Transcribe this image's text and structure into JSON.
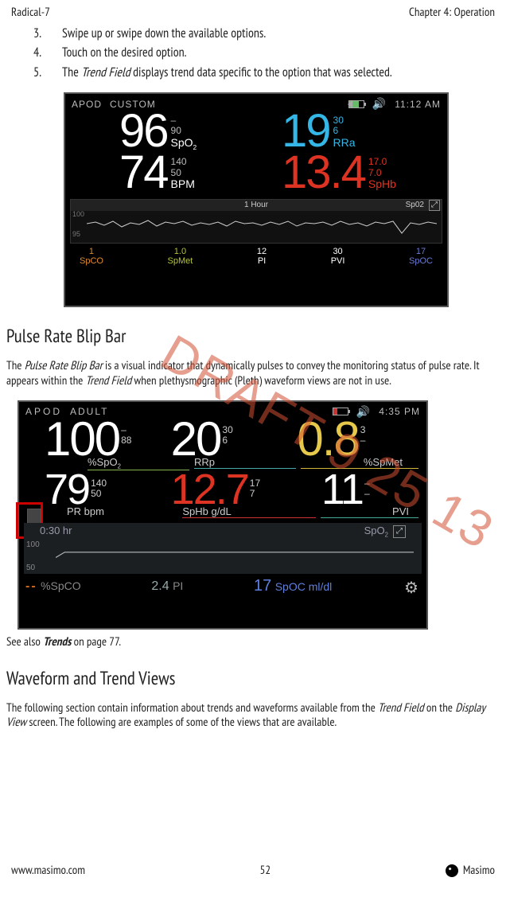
{
  "header": {
    "left": "Radical-7",
    "right": "Chapter 4: Operation"
  },
  "steps": [
    {
      "n": "3.",
      "text": "Swipe up or swipe down the available options."
    },
    {
      "n": "4.",
      "text": "Touch on the desired option."
    },
    {
      "n": "5.",
      "prefix": "The ",
      "em1": "Trend Field",
      "suffix": " displays trend data specific to the option that was selected."
    }
  ],
  "device1": {
    "status": {
      "mode1": "APOD",
      "mode2": "CUSTOM",
      "time": "11:12 AM"
    },
    "row1": {
      "spo2": {
        "v": "96",
        "hi": "–",
        "lo": "90",
        "lab": "SpO2"
      },
      "rra": {
        "v": "19",
        "hi": "30",
        "lo": "6",
        "lab": "RRa"
      }
    },
    "row2": {
      "bpm": {
        "v": "74",
        "hi": "140",
        "lo": "50",
        "lab": "BPM"
      },
      "sphb": {
        "v": "13.4",
        "hi": "17.0",
        "lo": "7.0",
        "lab": "SpHb"
      }
    },
    "trend": {
      "span": "1 Hour",
      "param": "Sp02",
      "y1": "100",
      "y2": "95"
    },
    "footer": [
      {
        "v": "1",
        "l": "SpCO",
        "cls": "orange"
      },
      {
        "v": "1.0",
        "l": "SpMet",
        "cls": "olive"
      },
      {
        "v": "12",
        "l": "PI",
        "cls": "white"
      },
      {
        "v": "30",
        "l": "PVI",
        "cls": "white"
      },
      {
        "v": "17",
        "l": "SpOC",
        "cls": "blue"
      }
    ]
  },
  "section1": {
    "title": "Pulse Rate Blip Bar",
    "p_a": "The ",
    "p_em1": "Pulse Rate Blip Bar",
    "p_b": " is a visual indicator that dynamically pulses to convey the monitoring status of pulse rate. It appears within the ",
    "p_em2": "Trend Field",
    "p_c": " when plethysmographic (Pleth) waveform views are not in use."
  },
  "device2": {
    "status": {
      "mode1": "APOD",
      "mode2": "ADULT",
      "time": "4:35 PM"
    },
    "row1": {
      "spo2": {
        "v": "100",
        "hi": "–",
        "lo": "88",
        "lab": "%SpO2"
      },
      "rrp": {
        "v": "20",
        "hi": "30",
        "lo": "6",
        "lab": "RRp"
      },
      "spmet": {
        "v": "0.8",
        "hi": "3",
        "lo": "–",
        "lab": "%SpMet"
      }
    },
    "row2": {
      "pr": {
        "v": "79",
        "hi": "140",
        "lo": "50",
        "lab": "PR bpm"
      },
      "sphb": {
        "v": "12.7",
        "hi": "17",
        "lo": "7",
        "lab": "SpHb g/dL"
      },
      "pvi": {
        "v": "11",
        "hi": "–",
        "lo": "–",
        "lab": "PVI"
      }
    },
    "trend": {
      "span": "0:30 hr",
      "param": "SpO2",
      "y1": "100",
      "y2": "50"
    },
    "footer": {
      "spco_dash": "--",
      "spco_lab": "%SpCO",
      "pi_v": "2.4",
      "pi_lab": "PI",
      "spoc_v": "17",
      "spoc_lab": "SpOC ml/dl"
    }
  },
  "caption": {
    "a": "See also ",
    "b": "Trends",
    "c": " on page 77."
  },
  "section2": {
    "title": "Waveform and Trend Views",
    "p_a": "The following section contain information about trends and waveforms available from the ",
    "p_em1": "Trend Field",
    "p_b": " on the ",
    "p_em2": "Display View",
    "p_c": " screen. The following are examples of some of the views that are available."
  },
  "watermark": "DRAFT 9 25 13",
  "footer": {
    "url": "www.masimo.com",
    "page": "52",
    "brand": "Masimo"
  }
}
